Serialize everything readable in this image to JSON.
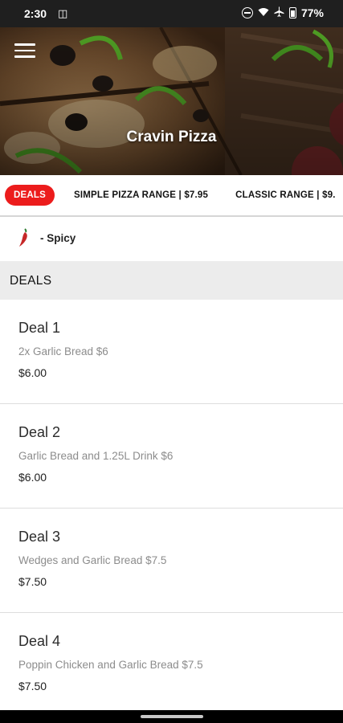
{
  "status_bar": {
    "time": "2:30",
    "left_icon": "sim-icon",
    "battery_percent": "77%",
    "icons": [
      "dnd-icon",
      "wifi-icon",
      "airplane-icon",
      "battery-icon"
    ]
  },
  "header": {
    "title": "Cravin Pizza",
    "menu_icon": "hamburger-menu-icon"
  },
  "tabs": [
    {
      "label": "DEALS",
      "active": true
    },
    {
      "label": "SIMPLE PIZZA RANGE | $7.95",
      "active": false
    },
    {
      "label": "CLASSIC RANGE | $9.",
      "active": false
    }
  ],
  "legend": {
    "icon": "chili-icon",
    "label": "- Spicy"
  },
  "section": {
    "title": "DEALS"
  },
  "items": [
    {
      "title": "Deal 1",
      "description": "2x Garlic Bread $6",
      "price": "$6.00"
    },
    {
      "title": "Deal 2",
      "description": "Garlic Bread and 1.25L Drink $6",
      "price": "$6.00"
    },
    {
      "title": "Deal 3",
      "description": "Wedges and Garlic Bread $7.5",
      "price": "$7.50"
    },
    {
      "title": "Deal 4",
      "description": "Poppin Chicken and Garlic Bread $7.5",
      "price": "$7.50"
    }
  ],
  "colors": {
    "accent": "#ec1c1c",
    "status_bar": "#1f1f1f",
    "section_bg": "#ececec"
  }
}
